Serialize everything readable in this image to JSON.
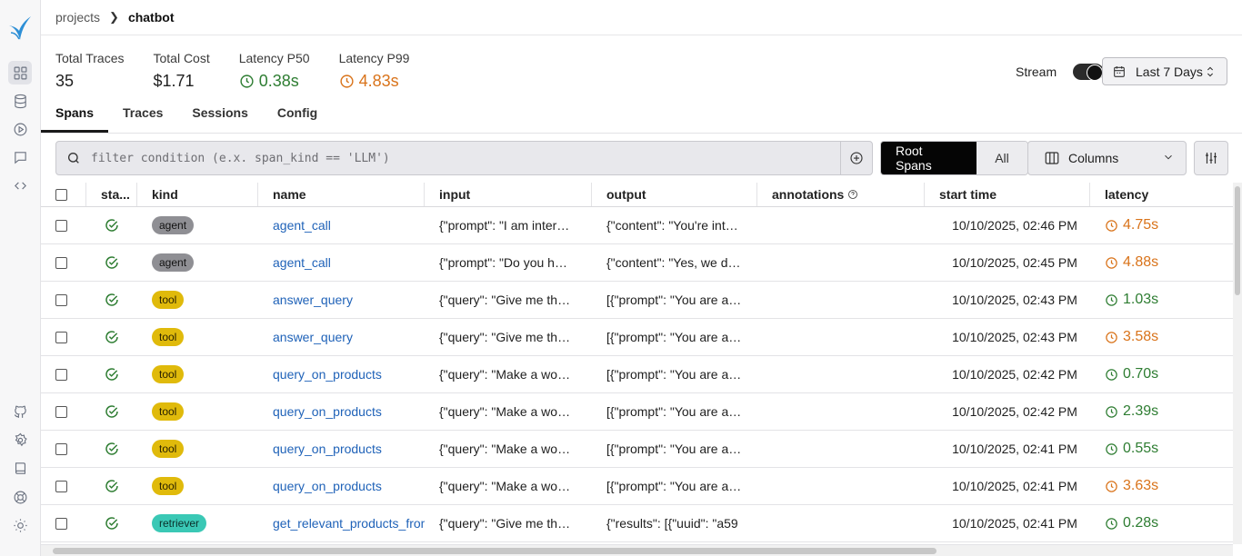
{
  "breadcrumb": {
    "parent": "projects",
    "current": "chatbot"
  },
  "stats": [
    {
      "label": "Total Traces",
      "value": "35",
      "tone": "plain"
    },
    {
      "label": "Total Cost",
      "value": "$1.71",
      "tone": "plain"
    },
    {
      "label": "Latency P50",
      "value": "0.38s",
      "tone": "green"
    },
    {
      "label": "Latency P99",
      "value": "4.83s",
      "tone": "orange"
    }
  ],
  "stream": {
    "label": "Stream",
    "enabled": true
  },
  "date_range": {
    "label": "Last 7 Days"
  },
  "tabs": [
    {
      "label": "Spans",
      "active": true
    },
    {
      "label": "Traces"
    },
    {
      "label": "Sessions"
    },
    {
      "label": "Config"
    }
  ],
  "filter": {
    "placeholder": "filter condition (e.x. span_kind == 'LLM')"
  },
  "span_toggle": {
    "root": "Root Spans",
    "all": "All"
  },
  "columns_button": {
    "label": "Columns"
  },
  "table": {
    "headers": {
      "status": "sta...",
      "kind": "kind",
      "name": "name",
      "input": "input",
      "output": "output",
      "annotations": "annotations",
      "start_time": "start time",
      "latency": "latency"
    },
    "rows": [
      {
        "kind": "agent",
        "name": "agent_call",
        "input": "{\"prompt\": \"I am interested in buying",
        "output": "{\"content\": \"You're interested in",
        "start": "10/10/2025, 02:46 PM",
        "latency": "4.75s",
        "tone": "orange"
      },
      {
        "kind": "agent",
        "name": "agent_call",
        "input": "{\"prompt\": \"Do you have any",
        "output": "{\"content\": \"Yes, we do have",
        "start": "10/10/2025, 02:45 PM",
        "latency": "4.88s",
        "tone": "orange"
      },
      {
        "kind": "tool",
        "name": "answer_query",
        "input": "{\"query\": \"Give me three",
        "output": "[{\"prompt\": \"You are a helpful",
        "start": "10/10/2025, 02:43 PM",
        "latency": "1.03s",
        "tone": "green"
      },
      {
        "kind": "tool",
        "name": "answer_query",
        "input": "{\"query\": \"Give me three",
        "output": "[{\"prompt\": \"You are a helpful",
        "start": "10/10/2025, 02:43 PM",
        "latency": "3.58s",
        "tone": "orange"
      },
      {
        "kind": "tool",
        "name": "query_on_products",
        "input": "{\"query\": \"Make a wonderful",
        "output": "[{\"prompt\": \"You are a helpful",
        "start": "10/10/2025, 02:42 PM",
        "latency": "0.70s",
        "tone": "green"
      },
      {
        "kind": "tool",
        "name": "query_on_products",
        "input": "{\"query\": \"Make a wonderful",
        "output": "[{\"prompt\": \"You are a helpful",
        "start": "10/10/2025, 02:42 PM",
        "latency": "2.39s",
        "tone": "green"
      },
      {
        "kind": "tool",
        "name": "query_on_products",
        "input": "{\"query\": \"Make a wonderful",
        "output": "[{\"prompt\": \"You are a helpful",
        "start": "10/10/2025, 02:41 PM",
        "latency": "0.55s",
        "tone": "green"
      },
      {
        "kind": "tool",
        "name": "query_on_products",
        "input": "{\"query\": \"Make a wonderful",
        "output": "[{\"prompt\": \"You are a helpful",
        "start": "10/10/2025, 02:41 PM",
        "latency": "3.63s",
        "tone": "orange"
      },
      {
        "kind": "retriever",
        "name": "get_relevant_products_from",
        "input": "{\"query\": \"Give me three",
        "output": "{\"results\": [{\"uuid\": \"a59",
        "start": "10/10/2025, 02:41 PM",
        "latency": "0.28s",
        "tone": "green"
      }
    ]
  },
  "icons": {
    "sidebar": [
      "grid-icon",
      "database-icon",
      "play-circle-icon",
      "chat-icon",
      "code-icon",
      "github-icon",
      "settings-gear-icon",
      "book-icon",
      "support-icon",
      "theme-icon"
    ],
    "colors": {
      "green": "#2e7d32",
      "orange": "#d9731a",
      "tool": "#e0ba0b",
      "agent": "#8f8f94",
      "retriever": "#3ac8b5",
      "link": "#1f62b8"
    }
  }
}
